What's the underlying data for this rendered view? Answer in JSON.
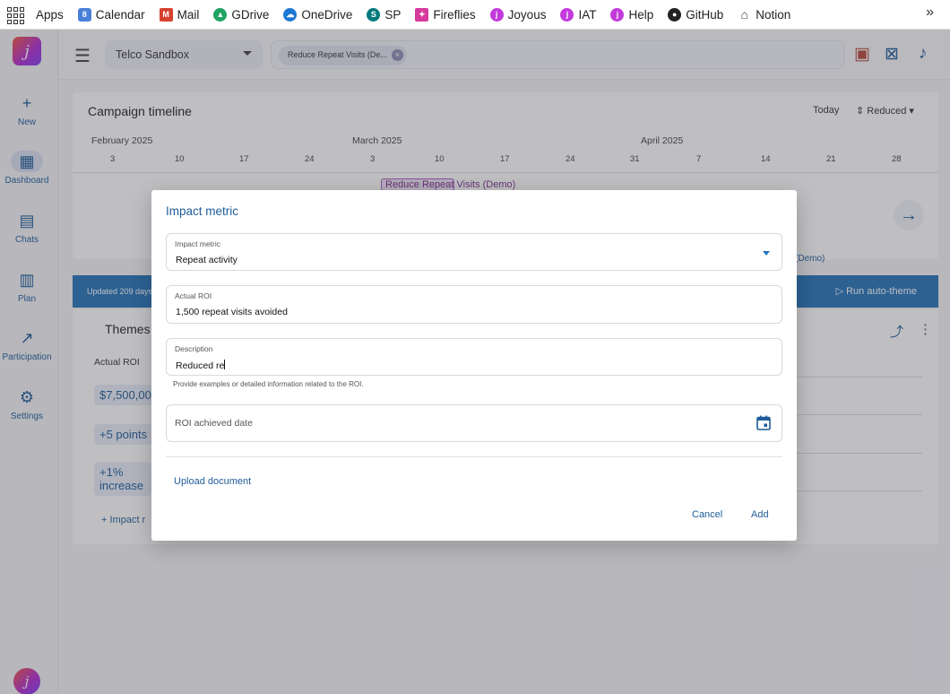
{
  "bookmarks": {
    "apps": "Apps",
    "items": [
      {
        "label": "Calendar",
        "color": "#4a7fd8"
      },
      {
        "label": "Mail",
        "color": "#d8412f"
      },
      {
        "label": "GDrive",
        "color": "#1fa463"
      },
      {
        "label": "OneDrive",
        "color": "#1c78d4"
      },
      {
        "label": "SP",
        "color": "#037a7c"
      },
      {
        "label": "Fireflies",
        "color": "#d63a9c"
      },
      {
        "label": "Joyous",
        "color": "#c23adb"
      },
      {
        "label": "IAT",
        "color": "#c23adb"
      },
      {
        "label": "Help",
        "color": "#c23adb"
      },
      {
        "label": "GitHub",
        "color": "#222222"
      },
      {
        "label": "Notion",
        "color": "#444444"
      }
    ],
    "more_icon": "chevron-double-right-icon"
  },
  "nav": {
    "logo": "j",
    "items": [
      {
        "label": "New",
        "icon": "plus-icon"
      },
      {
        "label": "Dashboard",
        "icon": "dashboard-icon"
      },
      {
        "label": "Chats",
        "icon": "chats-icon"
      },
      {
        "label": "Plan",
        "icon": "plan-icon"
      },
      {
        "label": "Participation",
        "icon": "trend-icon"
      },
      {
        "label": "Settings",
        "icon": "gear-icon"
      }
    ],
    "active": "Dashboard",
    "avatar": "j"
  },
  "header": {
    "workspace": "Telco Sandbox",
    "filter_chip": "Reduce Repeat Visits (De...",
    "chip_close": "×"
  },
  "timeline": {
    "title": "Campaign timeline",
    "today": "Today",
    "zoom": "Reduced",
    "months": [
      "February 2025",
      "March 2025",
      "April 2025"
    ],
    "days": [
      "3",
      "10",
      "17",
      "24",
      "3",
      "10",
      "17",
      "24",
      "31",
      "7",
      "14",
      "21",
      "28"
    ],
    "campaign_bar": "Reduce Repeat Visits (Demo)",
    "campaign_bar_2": "(Demo)"
  },
  "banner": {
    "updated": "Updated 209 days",
    "run": "Run auto-theme"
  },
  "themes": {
    "title": "Themes",
    "roi_header": "Actual ROI",
    "roi_values": [
      "$7,500,00",
      "+5 points",
      "+1% increase"
    ],
    "impact_link": "Impact r"
  },
  "modal": {
    "title": "Impact metric",
    "impact_metric": {
      "label": "Impact metric",
      "value": "Repeat activity"
    },
    "actual_roi": {
      "label": "Actual ROI",
      "value": "1,500 repeat visits avoided"
    },
    "description": {
      "label": "Description",
      "value": "Reduced re",
      "helper": "Provide examples or detailed information related to the ROI."
    },
    "date": {
      "placeholder": "ROI achieved date"
    },
    "upload": "Upload document",
    "cancel": "Cancel",
    "add": "Add"
  },
  "colors": {
    "accent": "#1f5c99",
    "banner": "#2473b8"
  }
}
